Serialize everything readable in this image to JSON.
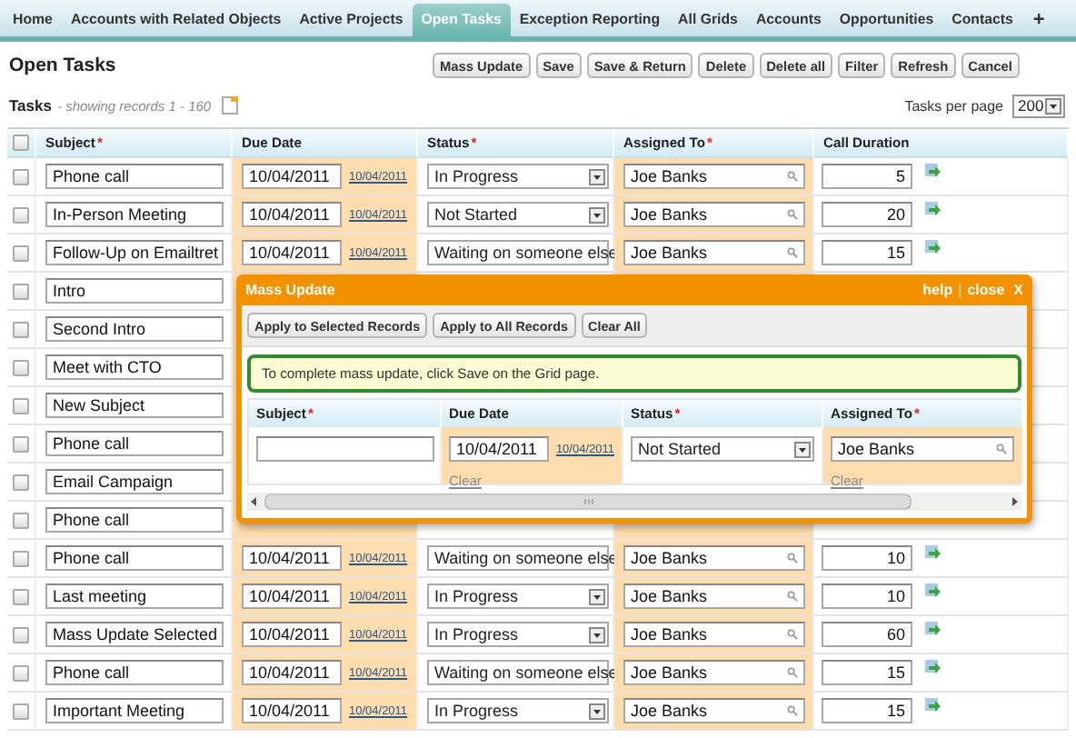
{
  "tabs": [
    {
      "label": "Home",
      "selected": false
    },
    {
      "label": "Accounts with Related Objects",
      "selected": false
    },
    {
      "label": "Active Projects",
      "selected": false
    },
    {
      "label": "Open Tasks",
      "selected": true
    },
    {
      "label": "Exception Reporting",
      "selected": false
    },
    {
      "label": "All Grids",
      "selected": false
    },
    {
      "label": "Accounts",
      "selected": false
    },
    {
      "label": "Opportunities",
      "selected": false
    },
    {
      "label": "Contacts",
      "selected": false
    }
  ],
  "add_tab": "+",
  "page_title": "Open Tasks",
  "buttons": [
    "Mass Update",
    "Save",
    "Save & Return",
    "Delete",
    "Delete all",
    "Filter",
    "Refresh",
    "Cancel"
  ],
  "list_title": "Tasks",
  "records_info": "- showing records 1 - 160",
  "per_page": {
    "label": "Tasks per page",
    "value": "200"
  },
  "grid": {
    "select_all_checked": false,
    "columns": [
      {
        "label": "Subject",
        "required_mark": "*"
      },
      {
        "label": "Due Date"
      },
      {
        "label": "Status",
        "required_mark": "*"
      },
      {
        "label": "Assigned To",
        "required_mark": "*"
      },
      {
        "label": "Call Duration"
      }
    ],
    "rows": [
      {
        "checked": false,
        "subject": "Phone call",
        "due_date": "10/04/2011",
        "date_link": "10/04/2011",
        "status": "In Progress",
        "assigned_to": "Joe Banks",
        "call_duration": "5"
      },
      {
        "checked": false,
        "subject": "In-Person Meeting",
        "due_date": "10/04/2011",
        "date_link": "10/04/2011",
        "status": "Not Started",
        "assigned_to": "Joe Banks",
        "call_duration": "20"
      },
      {
        "checked": false,
        "subject": "Follow-Up on Emailtret",
        "due_date": "10/04/2011",
        "date_link": "10/04/2011",
        "status": "Waiting on someone else",
        "assigned_to": "Joe Banks",
        "call_duration": "15"
      },
      {
        "checked": false,
        "subject": "Intro"
      },
      {
        "checked": false,
        "subject": "Second Intro"
      },
      {
        "checked": false,
        "subject": "Meet with CTO"
      },
      {
        "checked": false,
        "subject": "New Subject"
      },
      {
        "checked": false,
        "subject": "Phone call"
      },
      {
        "checked": false,
        "subject": "Email Campaign"
      },
      {
        "checked": false,
        "subject": "Phone call"
      },
      {
        "checked": false,
        "subject": "Phone call",
        "due_date": "10/04/2011",
        "date_link": "10/04/2011",
        "status": "Waiting on someone else",
        "assigned_to": "Joe Banks",
        "call_duration": "10"
      },
      {
        "checked": false,
        "subject": "Last meeting",
        "due_date": "10/04/2011",
        "date_link": "10/04/2011",
        "status": "In Progress",
        "assigned_to": "Joe Banks",
        "call_duration": "10"
      },
      {
        "checked": false,
        "subject": "Mass Update Selected",
        "due_date": "10/04/2011",
        "date_link": "10/04/2011",
        "status": "In Progress",
        "assigned_to": "Joe Banks",
        "call_duration": "60"
      },
      {
        "checked": false,
        "subject": "Phone call",
        "due_date": "10/04/2011",
        "date_link": "10/04/2011",
        "status": "Waiting on someone else",
        "assigned_to": "Joe Banks",
        "call_duration": "15"
      },
      {
        "checked": false,
        "subject": "Important Meeting",
        "due_date": "10/04/2011",
        "date_link": "10/04/2011",
        "status": "In Progress",
        "assigned_to": "Joe Banks",
        "call_duration": "15"
      }
    ]
  },
  "mass_update": {
    "title": "Mass Update",
    "help": "help",
    "separator": "|",
    "close": "close",
    "close_x": "X",
    "buttons": [
      "Apply to Selected Records",
      "Apply to All Records",
      "Clear All"
    ],
    "message": "To complete mass update, click Save on the Grid page.",
    "columns": [
      {
        "label": "Subject",
        "required_mark": "*"
      },
      {
        "label": "Due Date"
      },
      {
        "label": "Status",
        "required_mark": "*"
      },
      {
        "label": "Assigned To",
        "required_mark": "*"
      }
    ],
    "due_date": "10/04/2011",
    "date_link": "10/04/2011",
    "due_clear": "Clear",
    "status": "Not Started",
    "assigned_to": "Joe Banks",
    "assigned_clear": "Clear"
  }
}
